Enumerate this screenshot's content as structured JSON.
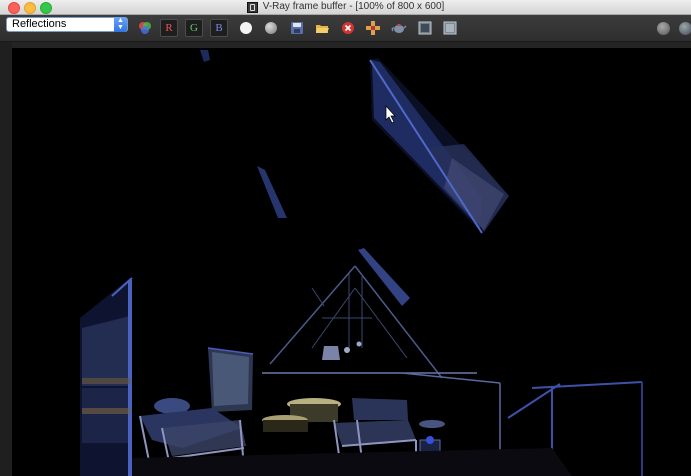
{
  "window": {
    "title": "V-Ray frame buffer - [100% of 800 x 600]"
  },
  "toolbar": {
    "channel_select": {
      "value": "Reflections"
    },
    "red_channel_label": "R",
    "green_channel_label": "G",
    "blue_channel_label": "B"
  },
  "colors": {
    "accent": "#2f74e0",
    "close": "#fc605b",
    "minimize": "#fdbc40",
    "maximize": "#34c84a",
    "render_bg": "#000000",
    "scene_highlight": "#3a5fcf"
  },
  "icons": [
    "rgb-channels-icon",
    "white-circle-icon",
    "gray-circle-icon",
    "save-image-icon",
    "open-folder-icon",
    "clear-image-icon",
    "region-render-icon",
    "teapot-render-icon",
    "track-mouse-icon",
    "history-icon",
    "settings-icon",
    "globe-icon"
  ]
}
